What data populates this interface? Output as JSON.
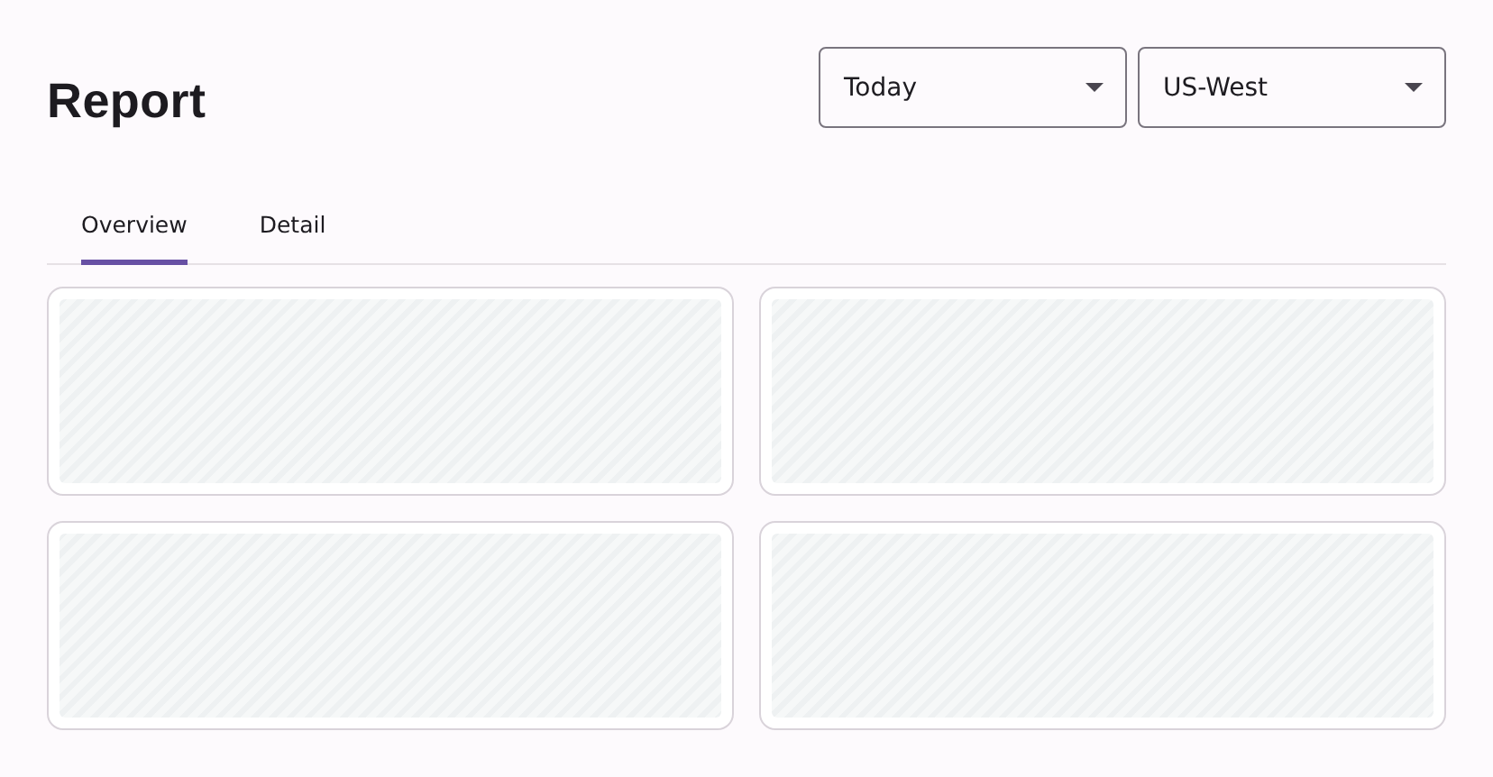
{
  "page": {
    "title": "Report"
  },
  "filters": [
    {
      "value": "Today"
    },
    {
      "value": "US-West"
    }
  ],
  "tabs": [
    {
      "label": "Overview",
      "selected": true
    },
    {
      "label": "Detail",
      "selected": false
    }
  ],
  "panels": [
    {
      "kind": "placeholder"
    },
    {
      "kind": "placeholder"
    },
    {
      "kind": "placeholder"
    },
    {
      "kind": "placeholder"
    }
  ]
}
